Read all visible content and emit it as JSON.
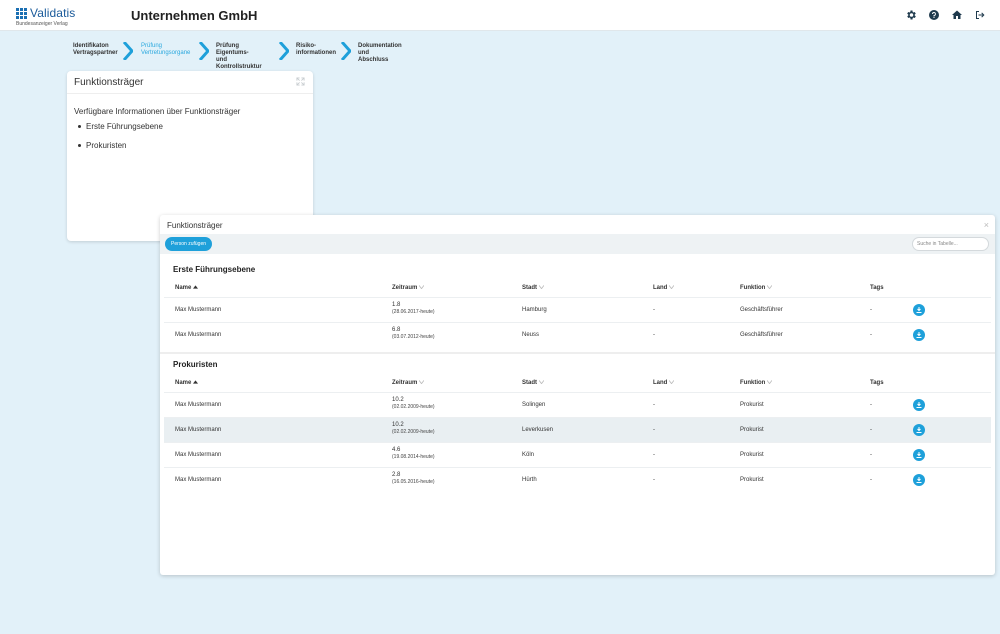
{
  "header": {
    "logo_name": "Validatis",
    "logo_sub": "Bundesanzeiger Verlag",
    "company": "Unternehmen GmbH",
    "icons": [
      "gear-icon",
      "help-icon",
      "home-icon",
      "logout-icon"
    ]
  },
  "stepper": [
    {
      "line1": "Identifikaton",
      "line2": "Vertragspartner",
      "active": false
    },
    {
      "line1": "Prüfung",
      "line2": "Vertretungsorgane",
      "active": true
    },
    {
      "line1": "Prüfung Eigentums-",
      "line2": "und Kontrollstruktur",
      "active": false
    },
    {
      "line1": "Risiko-",
      "line2": "informationen",
      "active": false
    },
    {
      "line1": "Dokumentation und",
      "line2": "Abschluss",
      "active": false
    }
  ],
  "card": {
    "title": "Funktionsträger",
    "intro": "Verfügbare Informationen über Funktionsträger",
    "items": [
      "Erste Führungsebene",
      "Prokuristen"
    ]
  },
  "modal": {
    "title": "Funktionsträger",
    "close": "×",
    "add_button": "Person zufügen",
    "search_placeholder": "Suche in Tabelle...",
    "columns": [
      "Name",
      "Zeitraum",
      "Stadt",
      "Land",
      "Funktion",
      "Tags"
    ],
    "sections": [
      {
        "title": "Erste Führungsebene",
        "rows": [
          {
            "name": "Max Mustermann",
            "zeit": "1.8",
            "zeit_sub": "(28.06.2017-heute)",
            "stadt": "Hamburg",
            "land": "-",
            "funktion": "Geschäftsführer",
            "tags": "-"
          },
          {
            "name": "Max Mustermann",
            "zeit": "6.8",
            "zeit_sub": "(03.07.2012-heute)",
            "stadt": "Neuss",
            "land": "-",
            "funktion": "Geschäftsführer",
            "tags": "-"
          }
        ]
      },
      {
        "title": "Prokuristen",
        "rows": [
          {
            "name": "Max Mustermann",
            "zeit": "10.2",
            "zeit_sub": "(02.02.2009-heute)",
            "stadt": "Solingen",
            "land": "-",
            "funktion": "Prokurist",
            "tags": "-"
          },
          {
            "name": "Max Mustermann",
            "zeit": "10.2",
            "zeit_sub": "(02.02.2009-heute)",
            "stadt": "Leverkusen",
            "land": "-",
            "funktion": "Prokurist",
            "tags": "-"
          },
          {
            "name": "Max Mustermann",
            "zeit": "4.6",
            "zeit_sub": "(19.08.2014-heute)",
            "stadt": "Köln",
            "land": "-",
            "funktion": "Prokurist",
            "tags": "-"
          },
          {
            "name": "Max Mustermann",
            "zeit": "2.8",
            "zeit_sub": "(16.05.2016-heute)",
            "stadt": "Hürth",
            "land": "-",
            "funktion": "Prokurist",
            "tags": "-"
          }
        ]
      }
    ]
  },
  "colors": {
    "accent": "#1ea0da",
    "background": "#e2f1f9",
    "brand": "#1a5a9a"
  }
}
